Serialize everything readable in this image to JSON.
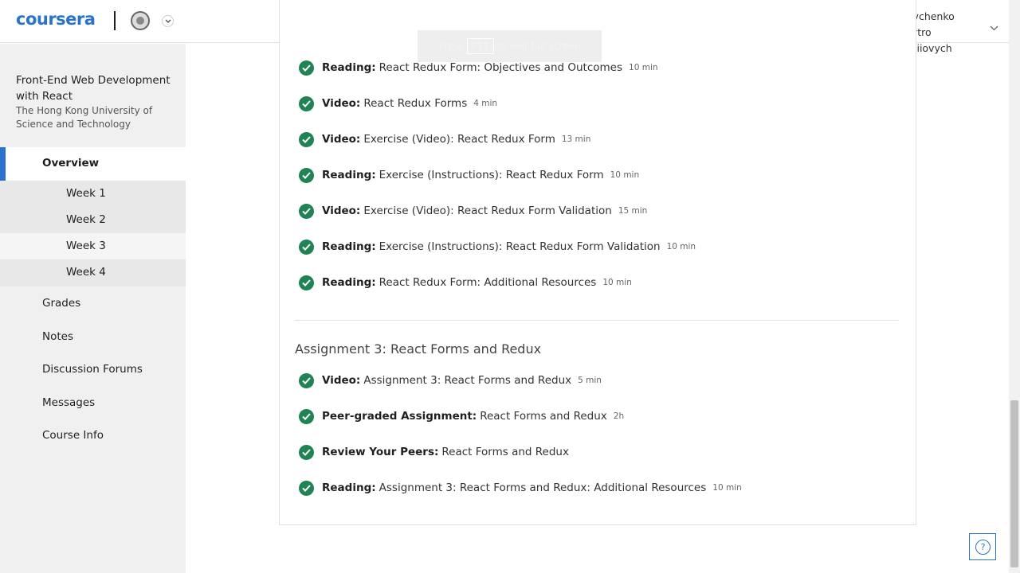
{
  "header": {
    "logo": "coursera",
    "user_name": "Shevchenko Dmytro Serhiiovych",
    "fullscreen_toast": {
      "press": "Press",
      "key": "F11",
      "rest": "to exit full screen"
    }
  },
  "sidebar": {
    "course_title": "Front-End Web Development with React",
    "course_org": "The Hong Kong University of Science and Technology",
    "overview": "Overview",
    "weeks": [
      "Week 1",
      "Week 2",
      "Week 3",
      "Week 4"
    ],
    "active_week": "Week 3",
    "nav": [
      "Grades",
      "Notes",
      "Discussion Forums",
      "Messages",
      "Course Info"
    ]
  },
  "main": {
    "items": [
      {
        "type": "Reading:",
        "title": "React Redux Form: Objectives and Outcomes",
        "duration": "10 min"
      },
      {
        "type": "Video:",
        "title": "React Redux Forms",
        "duration": "4 min"
      },
      {
        "type": "Video:",
        "title": "Exercise (Video): React Redux Form",
        "duration": "13 min"
      },
      {
        "type": "Reading:",
        "title": "Exercise (Instructions): React Redux Form",
        "duration": "10 min"
      },
      {
        "type": "Video:",
        "title": "Exercise (Video): React Redux Form Validation",
        "duration": "15 min"
      },
      {
        "type": "Reading:",
        "title": "Exercise (Instructions): React Redux Form Validation",
        "duration": "10 min"
      },
      {
        "type": "Reading:",
        "title": "React Redux Form: Additional Resources",
        "duration": "10 min"
      }
    ],
    "assignment_section": {
      "title": "Assignment 3: React Forms and Redux",
      "items": [
        {
          "type": "Video:",
          "title": "Assignment 3: React Forms and Redux",
          "duration": "5 min"
        },
        {
          "type": "Peer-graded Assignment:",
          "title": "React Forms and Redux",
          "duration": "2h"
        },
        {
          "type": "Review Your Peers:",
          "title": "React Forms and Redux",
          "duration": ""
        },
        {
          "type": "Reading:",
          "title": "Assignment 3: React Forms and Redux: Additional Resources",
          "duration": "10 min"
        }
      ]
    }
  },
  "help": {
    "label": "?"
  },
  "colors": {
    "brand": "#2a73cc",
    "complete": "#1f8354",
    "sidebar_bg": "#f0f0f0"
  },
  "icons": {
    "complete": "check-circle-icon",
    "help": "help-icon",
    "dropdown": "chevron-down-icon",
    "user": "user-avatar-icon"
  }
}
